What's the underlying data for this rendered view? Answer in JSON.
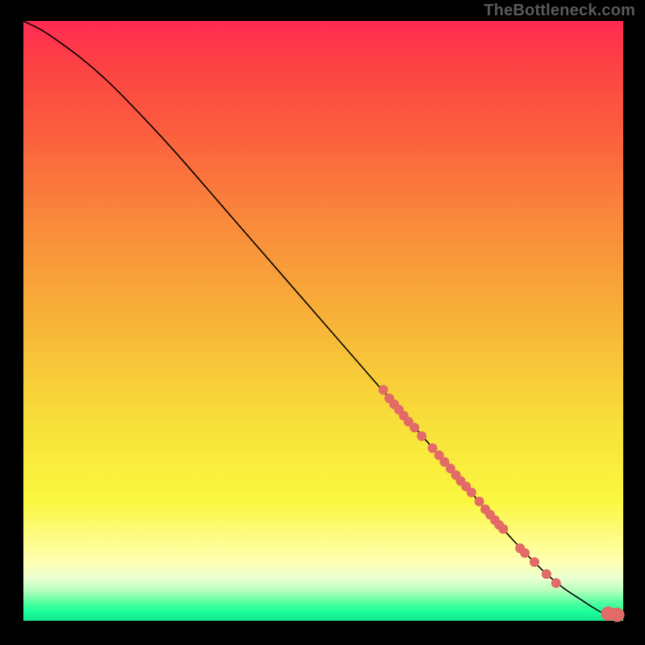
{
  "watermark": "TheBottleneck.com",
  "chart_data": {
    "type": "line",
    "title": "",
    "xlabel": "",
    "ylabel": "",
    "xlim": [
      0,
      100
    ],
    "ylim": [
      0,
      100
    ],
    "grid": false,
    "legend": false,
    "background_gradient": {
      "direction": "vertical",
      "stops": [
        {
          "pos": 0,
          "color": "#ff2a52"
        },
        {
          "pos": 0.07,
          "color": "#fc4144"
        },
        {
          "pos": 0.18,
          "color": "#fb5d3e"
        },
        {
          "pos": 0.33,
          "color": "#f9883b"
        },
        {
          "pos": 0.5,
          "color": "#f7b338"
        },
        {
          "pos": 0.68,
          "color": "#f8e23a"
        },
        {
          "pos": 0.8,
          "color": "#fbf73f"
        },
        {
          "pos": 0.9,
          "color": "#ffffb0"
        },
        {
          "pos": 0.93,
          "color": "#eaffd2"
        },
        {
          "pos": 0.95,
          "color": "#b3ffba"
        },
        {
          "pos": 0.97,
          "color": "#52ffa0"
        },
        {
          "pos": 0.985,
          "color": "#19ff9c"
        },
        {
          "pos": 1.0,
          "color": "#14e58c"
        }
      ]
    },
    "series": [
      {
        "name": "curve",
        "kind": "line",
        "color": "#000000",
        "x": [
          0,
          3,
          6,
          10,
          14,
          18,
          25,
          35,
          45,
          55,
          65,
          72,
          78,
          83,
          87,
          90,
          93,
          95,
          97,
          100
        ],
        "y": [
          100,
          98.5,
          96.5,
          93.5,
          90,
          86,
          78.5,
          67,
          55.5,
          44,
          32.5,
          24.5,
          17.5,
          12,
          8,
          5.5,
          3.5,
          2.2,
          1.2,
          1.0
        ]
      },
      {
        "name": "points",
        "kind": "scatter",
        "color": "#e26a67",
        "marker_radius_small": 6,
        "marker_radius_large": 9,
        "points": [
          {
            "x": 60.0,
            "y": 38.5,
            "r": 6
          },
          {
            "x": 61.0,
            "y": 37.1,
            "r": 6
          },
          {
            "x": 61.8,
            "y": 36.1,
            "r": 6
          },
          {
            "x": 62.6,
            "y": 35.2,
            "r": 6
          },
          {
            "x": 63.4,
            "y": 34.2,
            "r": 6
          },
          {
            "x": 64.2,
            "y": 33.2,
            "r": 6
          },
          {
            "x": 65.2,
            "y": 32.2,
            "r": 6
          },
          {
            "x": 66.4,
            "y": 30.8,
            "r": 6
          },
          {
            "x": 68.2,
            "y": 28.8,
            "r": 6
          },
          {
            "x": 69.3,
            "y": 27.6,
            "r": 6
          },
          {
            "x": 70.2,
            "y": 26.5,
            "r": 6
          },
          {
            "x": 71.2,
            "y": 25.4,
            "r": 6
          },
          {
            "x": 72.1,
            "y": 24.3,
            "r": 6
          },
          {
            "x": 72.9,
            "y": 23.3,
            "r": 6
          },
          {
            "x": 73.8,
            "y": 22.4,
            "r": 6
          },
          {
            "x": 74.7,
            "y": 21.4,
            "r": 6
          },
          {
            "x": 76.0,
            "y": 19.9,
            "r": 6
          },
          {
            "x": 77.0,
            "y": 18.6,
            "r": 6
          },
          {
            "x": 77.8,
            "y": 17.7,
            "r": 6
          },
          {
            "x": 78.6,
            "y": 16.8,
            "r": 6
          },
          {
            "x": 79.3,
            "y": 16.0,
            "r": 6
          },
          {
            "x": 80.0,
            "y": 15.3,
            "r": 6
          },
          {
            "x": 82.8,
            "y": 12.1,
            "r": 6
          },
          {
            "x": 83.6,
            "y": 11.3,
            "r": 6
          },
          {
            "x": 85.2,
            "y": 9.8,
            "r": 6
          },
          {
            "x": 87.2,
            "y": 7.8,
            "r": 6
          },
          {
            "x": 88.8,
            "y": 6.3,
            "r": 6
          },
          {
            "x": 97.5,
            "y": 1.2,
            "r": 9
          },
          {
            "x": 99.0,
            "y": 1.0,
            "r": 9
          }
        ]
      }
    ]
  }
}
